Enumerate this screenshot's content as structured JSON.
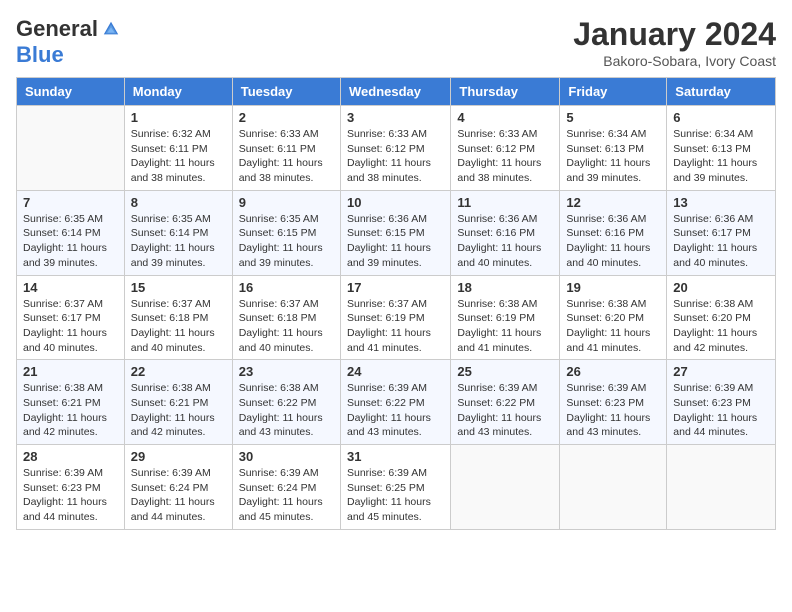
{
  "header": {
    "logo_general": "General",
    "logo_blue": "Blue",
    "month_title": "January 2024",
    "subtitle": "Bakoro-Sobara, Ivory Coast"
  },
  "days_of_week": [
    "Sunday",
    "Monday",
    "Tuesday",
    "Wednesday",
    "Thursday",
    "Friday",
    "Saturday"
  ],
  "weeks": [
    [
      {
        "day": "",
        "sunrise": "",
        "sunset": "",
        "daylight": ""
      },
      {
        "day": "1",
        "sunrise": "Sunrise: 6:32 AM",
        "sunset": "Sunset: 6:11 PM",
        "daylight": "Daylight: 11 hours and 38 minutes."
      },
      {
        "day": "2",
        "sunrise": "Sunrise: 6:33 AM",
        "sunset": "Sunset: 6:11 PM",
        "daylight": "Daylight: 11 hours and 38 minutes."
      },
      {
        "day": "3",
        "sunrise": "Sunrise: 6:33 AM",
        "sunset": "Sunset: 6:12 PM",
        "daylight": "Daylight: 11 hours and 38 minutes."
      },
      {
        "day": "4",
        "sunrise": "Sunrise: 6:33 AM",
        "sunset": "Sunset: 6:12 PM",
        "daylight": "Daylight: 11 hours and 38 minutes."
      },
      {
        "day": "5",
        "sunrise": "Sunrise: 6:34 AM",
        "sunset": "Sunset: 6:13 PM",
        "daylight": "Daylight: 11 hours and 39 minutes."
      },
      {
        "day": "6",
        "sunrise": "Sunrise: 6:34 AM",
        "sunset": "Sunset: 6:13 PM",
        "daylight": "Daylight: 11 hours and 39 minutes."
      }
    ],
    [
      {
        "day": "7",
        "sunrise": "Sunrise: 6:35 AM",
        "sunset": "Sunset: 6:14 PM",
        "daylight": "Daylight: 11 hours and 39 minutes."
      },
      {
        "day": "8",
        "sunrise": "Sunrise: 6:35 AM",
        "sunset": "Sunset: 6:14 PM",
        "daylight": "Daylight: 11 hours and 39 minutes."
      },
      {
        "day": "9",
        "sunrise": "Sunrise: 6:35 AM",
        "sunset": "Sunset: 6:15 PM",
        "daylight": "Daylight: 11 hours and 39 minutes."
      },
      {
        "day": "10",
        "sunrise": "Sunrise: 6:36 AM",
        "sunset": "Sunset: 6:15 PM",
        "daylight": "Daylight: 11 hours and 39 minutes."
      },
      {
        "day": "11",
        "sunrise": "Sunrise: 6:36 AM",
        "sunset": "Sunset: 6:16 PM",
        "daylight": "Daylight: 11 hours and 40 minutes."
      },
      {
        "day": "12",
        "sunrise": "Sunrise: 6:36 AM",
        "sunset": "Sunset: 6:16 PM",
        "daylight": "Daylight: 11 hours and 40 minutes."
      },
      {
        "day": "13",
        "sunrise": "Sunrise: 6:36 AM",
        "sunset": "Sunset: 6:17 PM",
        "daylight": "Daylight: 11 hours and 40 minutes."
      }
    ],
    [
      {
        "day": "14",
        "sunrise": "Sunrise: 6:37 AM",
        "sunset": "Sunset: 6:17 PM",
        "daylight": "Daylight: 11 hours and 40 minutes."
      },
      {
        "day": "15",
        "sunrise": "Sunrise: 6:37 AM",
        "sunset": "Sunset: 6:18 PM",
        "daylight": "Daylight: 11 hours and 40 minutes."
      },
      {
        "day": "16",
        "sunrise": "Sunrise: 6:37 AM",
        "sunset": "Sunset: 6:18 PM",
        "daylight": "Daylight: 11 hours and 40 minutes."
      },
      {
        "day": "17",
        "sunrise": "Sunrise: 6:37 AM",
        "sunset": "Sunset: 6:19 PM",
        "daylight": "Daylight: 11 hours and 41 minutes."
      },
      {
        "day": "18",
        "sunrise": "Sunrise: 6:38 AM",
        "sunset": "Sunset: 6:19 PM",
        "daylight": "Daylight: 11 hours and 41 minutes."
      },
      {
        "day": "19",
        "sunrise": "Sunrise: 6:38 AM",
        "sunset": "Sunset: 6:20 PM",
        "daylight": "Daylight: 11 hours and 41 minutes."
      },
      {
        "day": "20",
        "sunrise": "Sunrise: 6:38 AM",
        "sunset": "Sunset: 6:20 PM",
        "daylight": "Daylight: 11 hours and 42 minutes."
      }
    ],
    [
      {
        "day": "21",
        "sunrise": "Sunrise: 6:38 AM",
        "sunset": "Sunset: 6:21 PM",
        "daylight": "Daylight: 11 hours and 42 minutes."
      },
      {
        "day": "22",
        "sunrise": "Sunrise: 6:38 AM",
        "sunset": "Sunset: 6:21 PM",
        "daylight": "Daylight: 11 hours and 42 minutes."
      },
      {
        "day": "23",
        "sunrise": "Sunrise: 6:38 AM",
        "sunset": "Sunset: 6:22 PM",
        "daylight": "Daylight: 11 hours and 43 minutes."
      },
      {
        "day": "24",
        "sunrise": "Sunrise: 6:39 AM",
        "sunset": "Sunset: 6:22 PM",
        "daylight": "Daylight: 11 hours and 43 minutes."
      },
      {
        "day": "25",
        "sunrise": "Sunrise: 6:39 AM",
        "sunset": "Sunset: 6:22 PM",
        "daylight": "Daylight: 11 hours and 43 minutes."
      },
      {
        "day": "26",
        "sunrise": "Sunrise: 6:39 AM",
        "sunset": "Sunset: 6:23 PM",
        "daylight": "Daylight: 11 hours and 43 minutes."
      },
      {
        "day": "27",
        "sunrise": "Sunrise: 6:39 AM",
        "sunset": "Sunset: 6:23 PM",
        "daylight": "Daylight: 11 hours and 44 minutes."
      }
    ],
    [
      {
        "day": "28",
        "sunrise": "Sunrise: 6:39 AM",
        "sunset": "Sunset: 6:23 PM",
        "daylight": "Daylight: 11 hours and 44 minutes."
      },
      {
        "day": "29",
        "sunrise": "Sunrise: 6:39 AM",
        "sunset": "Sunset: 6:24 PM",
        "daylight": "Daylight: 11 hours and 44 minutes."
      },
      {
        "day": "30",
        "sunrise": "Sunrise: 6:39 AM",
        "sunset": "Sunset: 6:24 PM",
        "daylight": "Daylight: 11 hours and 45 minutes."
      },
      {
        "day": "31",
        "sunrise": "Sunrise: 6:39 AM",
        "sunset": "Sunset: 6:25 PM",
        "daylight": "Daylight: 11 hours and 45 minutes."
      },
      {
        "day": "",
        "sunrise": "",
        "sunset": "",
        "daylight": ""
      },
      {
        "day": "",
        "sunrise": "",
        "sunset": "",
        "daylight": ""
      },
      {
        "day": "",
        "sunrise": "",
        "sunset": "",
        "daylight": ""
      }
    ]
  ]
}
